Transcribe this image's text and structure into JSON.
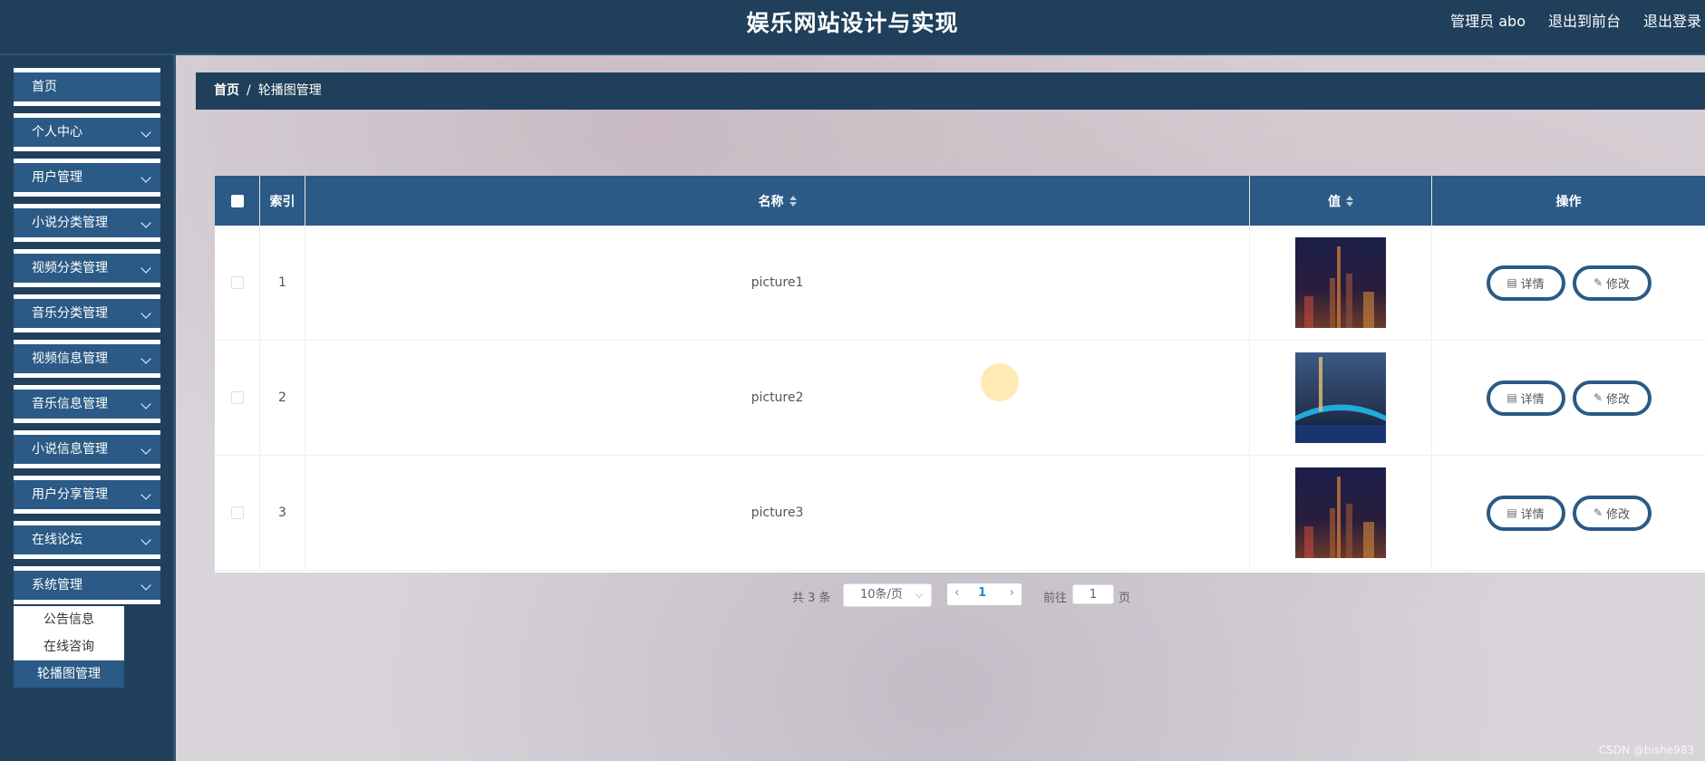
{
  "header": {
    "title": "娱乐网站设计与实现",
    "user_label": "管理员 abo",
    "front_link": "退出到前台",
    "logout_link": "退出登录"
  },
  "sidebar": {
    "items": [
      {
        "label": "首页",
        "has_arrow": false
      },
      {
        "label": "个人中心",
        "has_arrow": true
      },
      {
        "label": "用户管理",
        "has_arrow": true
      },
      {
        "label": "小说分类管理",
        "has_arrow": true
      },
      {
        "label": "视频分类管理",
        "has_arrow": true
      },
      {
        "label": "音乐分类管理",
        "has_arrow": true
      },
      {
        "label": "视频信息管理",
        "has_arrow": true
      },
      {
        "label": "音乐信息管理",
        "has_arrow": true
      },
      {
        "label": "小说信息管理",
        "has_arrow": true
      },
      {
        "label": "用户分享管理",
        "has_arrow": true
      },
      {
        "label": "在线论坛",
        "has_arrow": true
      },
      {
        "label": "系统管理",
        "has_arrow": true
      }
    ],
    "submenu": [
      {
        "label": "公告信息"
      },
      {
        "label": "在线咨询"
      },
      {
        "label": "轮播图管理",
        "active": true
      }
    ]
  },
  "breadcrumb": {
    "home": "首页",
    "separator": "/",
    "current": "轮播图管理"
  },
  "table": {
    "columns": {
      "index": "索引",
      "name": "名称",
      "value": "值",
      "ops": "操作"
    },
    "rows": [
      {
        "index": "1",
        "name": "picture1",
        "image": "city-night-tower"
      },
      {
        "index": "2",
        "name": "picture2",
        "image": "bridge-night"
      },
      {
        "index": "3",
        "name": "picture3",
        "image": "city-night-tower"
      }
    ],
    "detail_label": "详情",
    "edit_label": "修改"
  },
  "pagination": {
    "total": "共 3 条",
    "page_size": "10条/页",
    "current_page": "1",
    "goto_label": "前往",
    "goto_value": "1",
    "page_suffix": "页"
  },
  "watermark": "CSDN @bishe983",
  "colors": {
    "header_bg": "#1f3f5a",
    "accent": "#2a5a85",
    "active_page": "#2a8ac8"
  }
}
